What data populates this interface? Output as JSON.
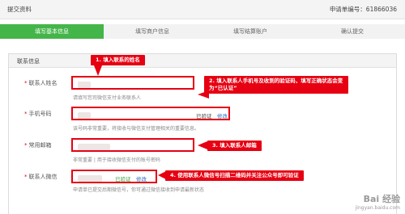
{
  "header": {
    "title": "提交资料",
    "application_no": "申请单编号：61866036"
  },
  "steps": [
    {
      "label": "填写基本信息",
      "active": true
    },
    {
      "label": "填写商户信息",
      "active": false
    },
    {
      "label": "填写结算账户",
      "active": false
    },
    {
      "label": "确认提交",
      "active": false
    }
  ],
  "section": {
    "title": "联系信息"
  },
  "form": {
    "name": {
      "label": "联系人姓名",
      "hint": "请填写您司微信支付业务联系人"
    },
    "phone": {
      "label": "手机号码",
      "hint": "该号码非常重要，将接收与微信支付管理相关的重要信息。",
      "verified": "已验证",
      "modify": "修改"
    },
    "email": {
      "label": "常用邮箱",
      "hint": "非常重要 | 用于接收微信支付的账号密码"
    },
    "wechat": {
      "label": "联系人微信",
      "hint": "申请单已提交后期微信号，你可通过微信接收到申请最新状态",
      "verified": "已验证",
      "modify": "修改"
    }
  },
  "callouts": {
    "c1": "1. 填入联系的姓名",
    "c2": "2. 填入联系人手机号及收到的验证码，填写正确状态会变为“已认证”",
    "c3": "3. 填入联系人邮箱",
    "c4": "4. 使用联系人微信号扫描二维码并关注公众号即可验证"
  },
  "colors": {
    "accent": "#44b549",
    "callout": "#e60012",
    "link": "#2a6fbf"
  },
  "watermark": {
    "logo": "Bai 经验",
    "url": "jingyan.baidu.com"
  }
}
